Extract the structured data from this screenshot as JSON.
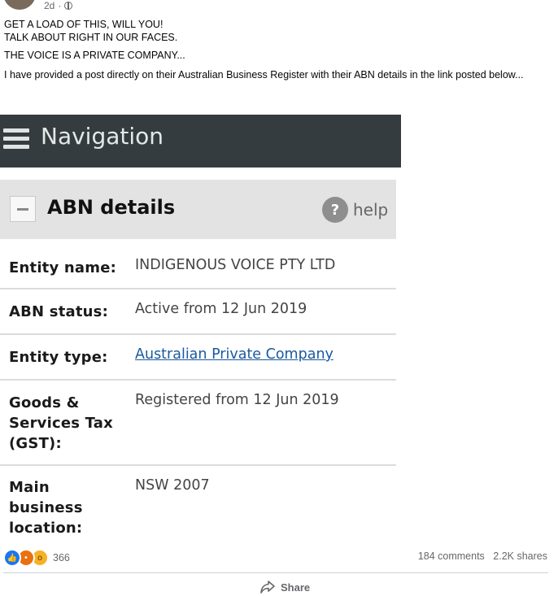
{
  "post": {
    "time": "2d",
    "privacy_icon": "globe-icon",
    "lines": [
      "GET A LOAD OF THIS, WILL YOU!",
      "TALK ABOUT RIGHT IN OUR FACES.",
      "THE VOICE IS A PRIVATE COMPANY...",
      "I have provided a post directly on their Australian Business Register with their ABN details in the link posted below..."
    ]
  },
  "screenshot": {
    "nav_title": "Navigation",
    "section_title": "ABN details",
    "help_label": "help",
    "rows": [
      {
        "label": "Entity name:",
        "value": "INDIGENOUS VOICE PTY LTD"
      },
      {
        "label": "ABN status:",
        "value": "Active from 12 Jun 2019"
      },
      {
        "label": "Entity type:",
        "value": "Australian Private Company"
      },
      {
        "label": "Goods & Services Tax (GST):",
        "value": "Registered from 12 Jun 2019"
      },
      {
        "label": "Main business location:",
        "value": "NSW 2007"
      }
    ]
  },
  "engagement": {
    "reaction_count": "366",
    "comments": "184 comments",
    "shares": "2.2K shares",
    "share_label": "Share"
  },
  "colors": {
    "nav_bg": "#353c3f",
    "section_bg": "#e3e3e3",
    "link": "#1a5aa0",
    "like": "#1877f2"
  }
}
